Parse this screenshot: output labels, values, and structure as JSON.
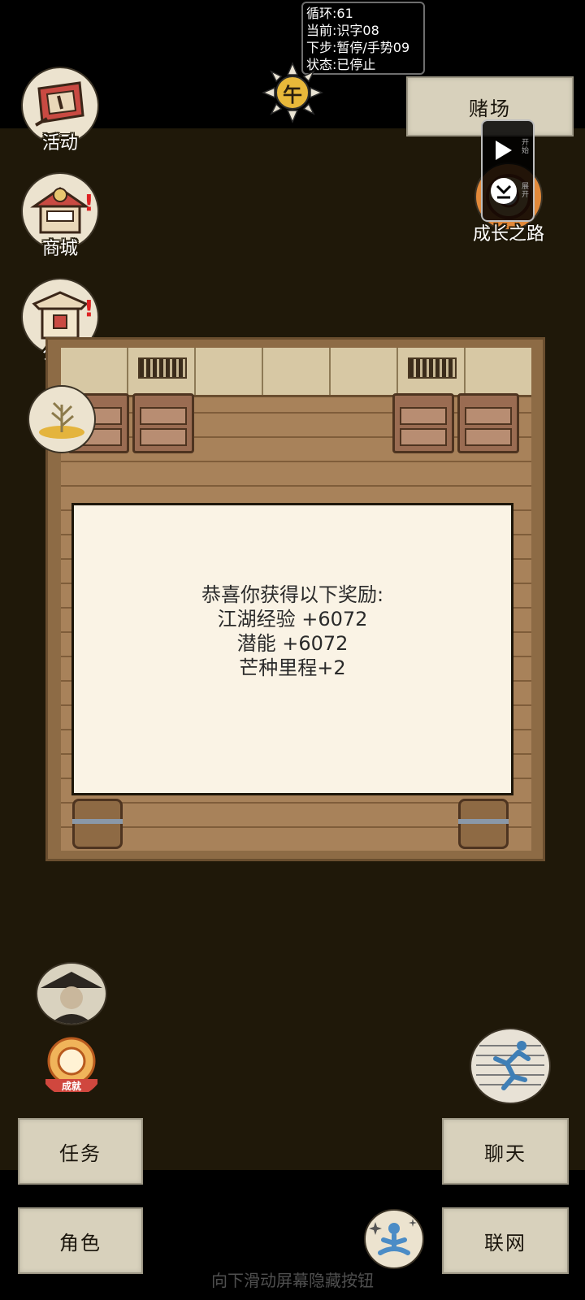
{
  "debug": {
    "loop": "循环:61",
    "current": "当前:识字08",
    "next": "下步:暂停/手势09",
    "status": "状态:已停止"
  },
  "time_label": "午",
  "casino_label": "赌场",
  "fab": {
    "start": "开始",
    "expand": "展开"
  },
  "left_menu": [
    {
      "label": "活动",
      "icon": "banner-icon"
    },
    {
      "label": "商城",
      "icon": "shop-icon"
    },
    {
      "label": "公告",
      "icon": "notice-board-icon"
    },
    {
      "label": "",
      "icon": "wheat-icon"
    }
  ],
  "growth_label": "成长之路",
  "reward": {
    "title": "恭喜你获得以下奖励:",
    "lines": [
      "江湖经验 +6072",
      "潜能 +6072",
      "芒种里程+2"
    ]
  },
  "achievement_label": "成就",
  "bottom": {
    "task": "任务",
    "role": "角色",
    "chat": "聊天",
    "network": "联网"
  },
  "hint": "向下滑动屏幕隐藏按钮"
}
